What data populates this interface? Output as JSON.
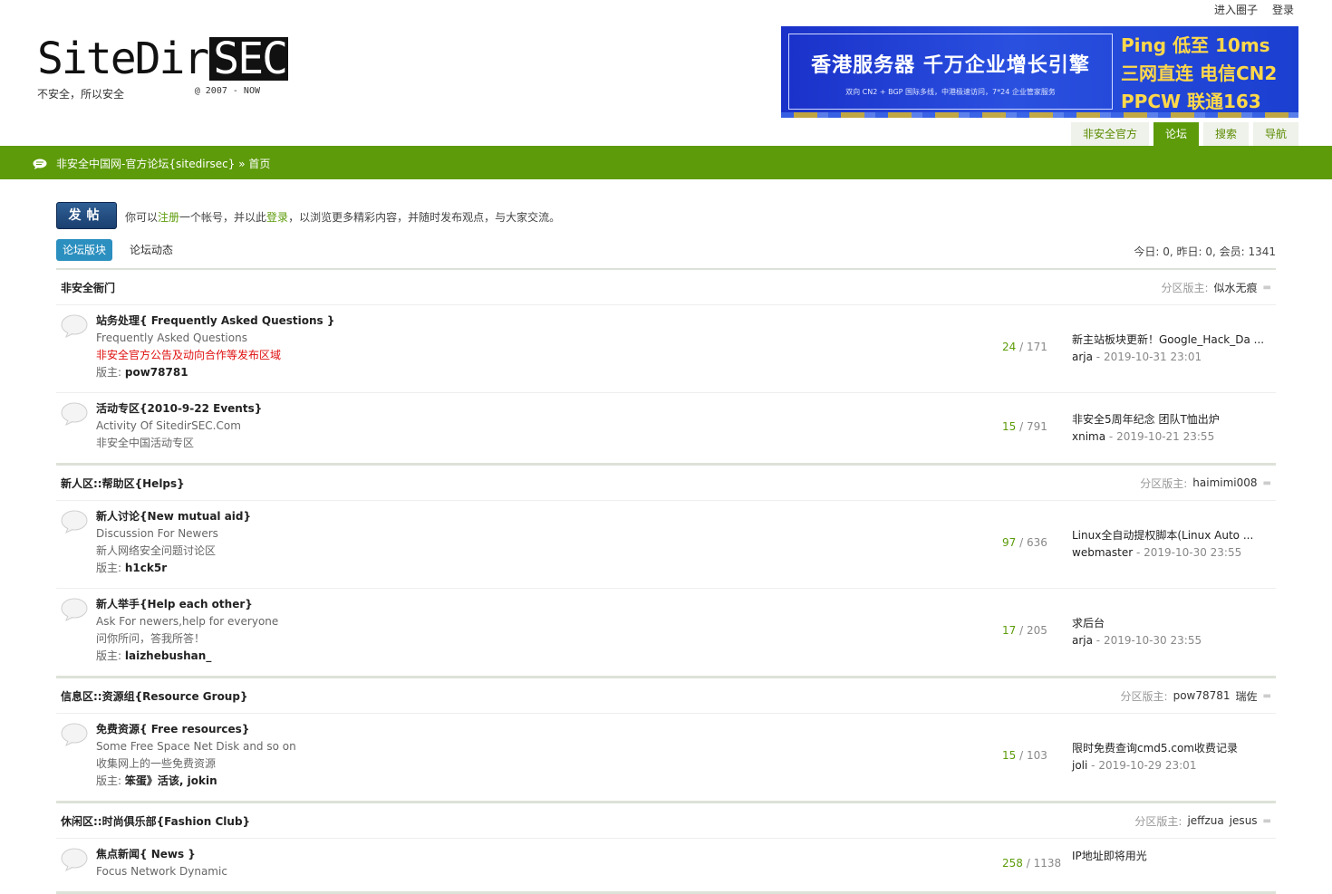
{
  "top_links": [
    "进入圈子",
    "登录"
  ],
  "logo": {
    "main": "SiteDir",
    "sec": "SEC",
    "slogan": "不安全，所以安全",
    "copyright": "@ 2007 - NOW"
  },
  "banner": {
    "title": "香港服务器 千万企业增长引擎",
    "subtitle": "双向 CN2 + BGP 国际多线，中港极速访问，7*24 企业管家服务",
    "right_lines": [
      "Ping 低至 10ms",
      "三网直连 电信CN2",
      "PPCW 联通163"
    ]
  },
  "nav": [
    "非安全官方",
    "论坛",
    "搜索",
    "导航"
  ],
  "breadcrumb": "非安全中国网-官方论坛{sitedirsec} » 首页",
  "post_button": "发帖",
  "notice": {
    "prefix": "你可以",
    "register": "注册",
    "middle": "一个帐号，并以此",
    "login": "登录",
    "suffix": "，以浏览更多精彩内容，并随时发布观点，与大家交流。"
  },
  "tabs": [
    "论坛版块",
    "论坛动态"
  ],
  "stats": "今日: 0, 昨日: 0, 会员: 1341",
  "mods_label": "分区版主:",
  "mod_label": "版主:",
  "categories": [
    {
      "title": "非安全衙门",
      "mods": [
        "似水无痕"
      ],
      "forums": [
        {
          "name": "站务处理{ Frequently Asked Questions }",
          "desc": "Frequently Asked Questions",
          "desc2": "非安全官方公告及动向合作等发布区域",
          "mods": "pow78781",
          "topics": "24",
          "posts": "171",
          "last_title": "新主站板块更新！Google_Hack_Da ...",
          "last_user": "arja",
          "last_time": "2019-10-31 23:01"
        },
        {
          "name": "活动专区{2010-9-22 Events}",
          "desc": "Activity Of SitedirSEC.Com",
          "desc2": "非安全中国活动专区",
          "mods": "",
          "topics": "15",
          "posts": "791",
          "last_title": "非安全5周年纪念 团队T恤出炉",
          "last_user": "xnima",
          "last_time": "2019-10-21 23:55"
        }
      ]
    },
    {
      "title": "新人区::帮助区{Helps}",
      "mods": [
        "haimimi008"
      ],
      "forums": [
        {
          "name": "新人讨论{New mutual aid}",
          "desc": "Discussion For Newers",
          "desc2": "新人网络安全问题讨论区",
          "mods": "h1ck5r",
          "topics": "97",
          "posts": "636",
          "last_title": "Linux全自动提权脚本(Linux Auto ...",
          "last_user": "webmaster",
          "last_time": "2019-10-30 23:55"
        },
        {
          "name": "新人举手{Help each other}",
          "desc": "Ask For newers,help for everyone",
          "desc2": "问你所问，答我所答！",
          "mods": "laizhebushan_",
          "topics": "17",
          "posts": "205",
          "last_title": "求后台",
          "last_user": "arja",
          "last_time": "2019-10-30 23:55"
        }
      ]
    },
    {
      "title": "信息区::资源组{Resource Group}",
      "mods": [
        "pow78781",
        "瑞佐"
      ],
      "forums": [
        {
          "name": "免费资源{ Free resources}",
          "desc": "Some Free Space Net Disk and so on",
          "desc2": "收集网上的一些免费资源",
          "mods": "笨蛋》活该, jokin",
          "topics": "15",
          "posts": "103",
          "last_title": "限时免费查询cmd5.com收费记录",
          "last_user": "joli",
          "last_time": "2019-10-29 23:01"
        }
      ]
    },
    {
      "title": "休闲区::时尚俱乐部{Fashion Club}",
      "mods": [
        "jeffzua",
        "jesus"
      ],
      "forums": [
        {
          "name": "焦点新闻{ News }",
          "desc": "Focus Network Dynamic",
          "desc2": "",
          "mods": "",
          "topics": "258",
          "posts": "1138",
          "last_title": "IP地址即将用光",
          "last_user": "",
          "last_time": ""
        }
      ]
    }
  ]
}
